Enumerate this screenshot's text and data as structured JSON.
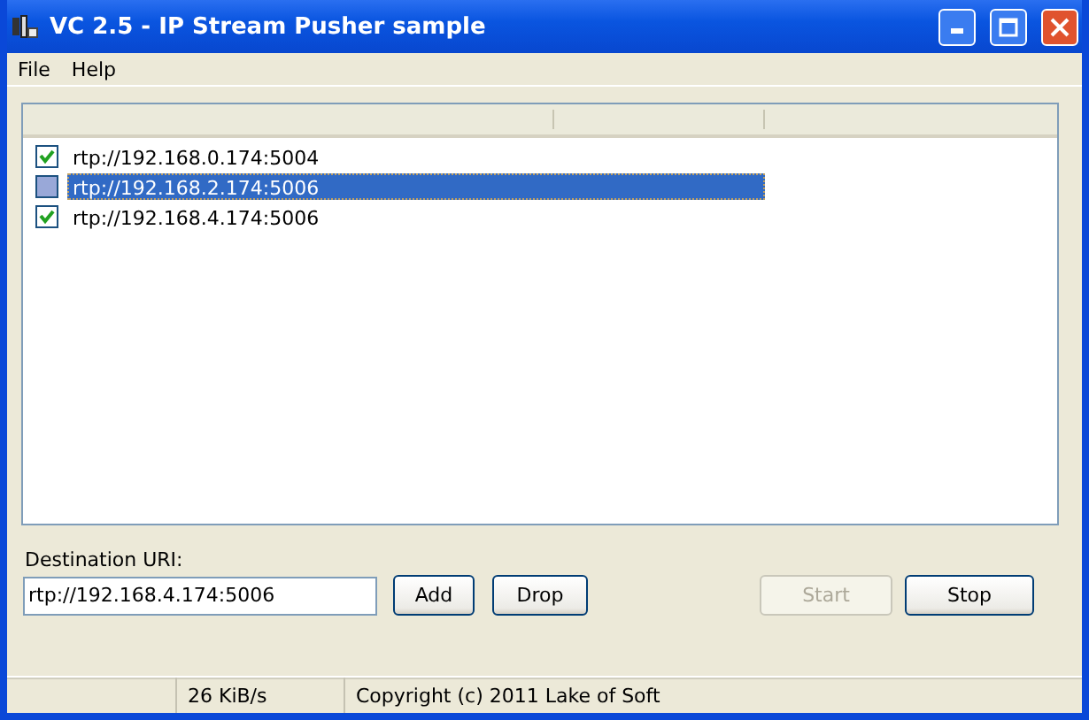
{
  "window": {
    "title": "VC 2.5 - IP Stream Pusher sample"
  },
  "menu": [
    "File",
    "Help"
  ],
  "list": {
    "rows": [
      {
        "label": "rtp://192.168.0.174:5004",
        "checked": true,
        "selected": false
      },
      {
        "label": "rtp://192.168.2.174:5006",
        "checked": false,
        "selected": true
      },
      {
        "label": "rtp://192.168.4.174:5006",
        "checked": true,
        "selected": false
      }
    ]
  },
  "destination": {
    "label": "Destination URI:",
    "value": "rtp://192.168.4.174:5006"
  },
  "buttons": [
    {
      "label": "Add",
      "disabled": false
    },
    {
      "label": "Drop",
      "disabled": false
    },
    {
      "label": "Start",
      "disabled": true
    },
    {
      "label": "Stop",
      "disabled": false
    }
  ],
  "status_bar": [
    "26 KiB/s",
    "Copyright (c) 2011 Lake of Soft"
  ]
}
